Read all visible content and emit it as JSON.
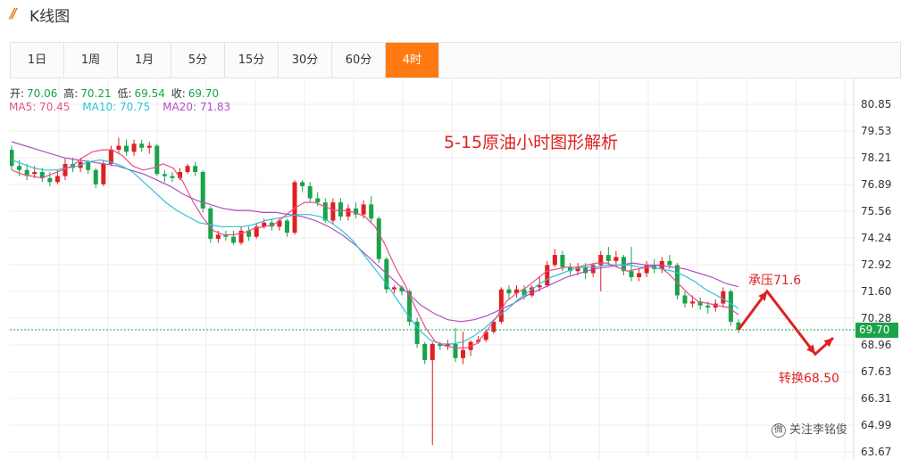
{
  "header": {
    "title": "K线图",
    "icon": "double-slash-icon",
    "accent": "#f07c14"
  },
  "tabs": [
    {
      "label": "1日"
    },
    {
      "label": "1周"
    },
    {
      "label": "1月"
    },
    {
      "label": "5分"
    },
    {
      "label": "15分"
    },
    {
      "label": "30分"
    },
    {
      "label": "60分"
    },
    {
      "label": "4时",
      "active": true
    }
  ],
  "ohlc": {
    "open_label": "开:",
    "open": "70.06",
    "high_label": "高:",
    "high": "70.21",
    "low_label": "低:",
    "low": "69.54",
    "close_label": "收:",
    "close": "69.70"
  },
  "ma": {
    "ma5": "MA5: 70.45",
    "ma10": "MA10: 70.75",
    "ma20": "MA20: 71.83"
  },
  "annotations": {
    "title": "5-15原油小时图形解析",
    "resistance": "承压71.6",
    "target": "转换68.50"
  },
  "watermark": {
    "text": "关注李铭俊",
    "icon": "weibo-icon"
  },
  "current_price": "69.70",
  "colors": {
    "up": "#e02020",
    "down": "#1aa34a",
    "ma5": "#e8508a",
    "ma10": "#2ec4d6",
    "ma20": "#b04fc4",
    "annotation": "#e02020",
    "tab_active": "#ff7a12"
  },
  "chart_data": {
    "type": "candlestick",
    "y_ticks": [
      "80.85",
      "79.53",
      "78.21",
      "76.89",
      "75.56",
      "74.24",
      "72.92",
      "71.60",
      "70.28",
      "68.96",
      "67.63",
      "66.31",
      "64.99",
      "63.67"
    ],
    "ylim": [
      63.67,
      80.85
    ],
    "grid": true,
    "candles": [
      [
        78.6,
        77.8,
        78.8,
        77.6
      ],
      [
        77.8,
        77.6,
        78.1,
        77.3
      ],
      [
        77.6,
        77.3,
        77.9,
        77.1
      ],
      [
        77.4,
        77.5,
        77.8,
        77.2
      ],
      [
        77.5,
        77.2,
        77.7,
        77.0
      ],
      [
        77.2,
        77.0,
        77.5,
        76.8
      ],
      [
        77.0,
        77.3,
        77.6,
        76.9
      ],
      [
        77.3,
        77.9,
        78.2,
        77.1
      ],
      [
        77.9,
        77.7,
        78.2,
        77.5
      ],
      [
        77.7,
        78.0,
        78.2,
        77.5
      ],
      [
        78.0,
        77.6,
        78.1,
        77.4
      ],
      [
        77.6,
        76.9,
        77.7,
        76.7
      ],
      [
        76.9,
        77.9,
        78.1,
        76.8
      ],
      [
        77.9,
        78.6,
        78.8,
        77.8
      ],
      [
        78.6,
        78.8,
        79.2,
        78.4
      ],
      [
        78.8,
        78.5,
        79.1,
        78.3
      ],
      [
        78.5,
        78.9,
        79.1,
        78.3
      ],
      [
        78.9,
        78.7,
        79.1,
        78.5
      ],
      [
        78.7,
        78.8,
        79.0,
        78.4
      ],
      [
        78.8,
        77.4,
        78.9,
        77.3
      ],
      [
        77.4,
        77.3,
        77.6,
        77.0
      ],
      [
        77.3,
        77.2,
        77.5,
        77.0
      ],
      [
        77.2,
        77.5,
        77.7,
        77.1
      ],
      [
        77.5,
        77.8,
        77.9,
        77.4
      ],
      [
        77.8,
        77.5,
        78.0,
        77.3
      ],
      [
        77.5,
        75.7,
        77.6,
        75.5
      ],
      [
        75.7,
        74.2,
        75.8,
        74.0
      ],
      [
        74.2,
        74.4,
        74.6,
        74.0
      ],
      [
        74.4,
        74.3,
        74.6,
        74.1
      ],
      [
        74.3,
        74.0,
        74.6,
        73.9
      ],
      [
        74.0,
        74.6,
        74.8,
        73.9
      ],
      [
        74.6,
        74.3,
        74.8,
        74.1
      ],
      [
        74.3,
        74.8,
        75.0,
        74.2
      ],
      [
        74.8,
        75.0,
        75.2,
        74.7
      ],
      [
        75.0,
        74.8,
        75.2,
        74.6
      ],
      [
        74.8,
        75.1,
        75.2,
        74.6
      ],
      [
        75.1,
        74.5,
        75.2,
        74.3
      ],
      [
        74.5,
        77.0,
        77.1,
        74.4
      ],
      [
        77.0,
        76.8,
        77.1,
        76.5
      ],
      [
        76.8,
        76.2,
        77.0,
        76.0
      ],
      [
        76.2,
        76.0,
        76.5,
        75.8
      ],
      [
        76.0,
        75.1,
        76.2,
        75.0
      ],
      [
        75.1,
        76.0,
        76.2,
        74.9
      ],
      [
        76.0,
        75.3,
        76.2,
        75.1
      ],
      [
        75.3,
        75.7,
        75.9,
        75.1
      ],
      [
        75.7,
        75.4,
        76.0,
        75.2
      ],
      [
        75.4,
        75.9,
        76.1,
        75.2
      ],
      [
        75.9,
        75.2,
        76.3,
        75.0
      ],
      [
        75.2,
        73.2,
        75.3,
        73.0
      ],
      [
        73.2,
        71.7,
        73.3,
        71.5
      ],
      [
        71.7,
        71.8,
        71.9,
        71.5
      ],
      [
        71.8,
        71.6,
        71.9,
        71.4
      ],
      [
        71.6,
        70.1,
        71.7,
        69.9
      ],
      [
        70.1,
        69.0,
        70.3,
        68.8
      ],
      [
        69.0,
        68.2,
        69.1,
        68.0
      ],
      [
        68.2,
        69.0,
        69.1,
        64.0
      ],
      [
        69.0,
        68.9,
        69.1,
        68.7
      ],
      [
        68.9,
        69.0,
        69.2,
        68.7
      ],
      [
        69.0,
        68.3,
        69.8,
        68.1
      ],
      [
        68.3,
        68.7,
        69.6,
        68.0
      ],
      [
        68.7,
        69.1,
        69.2,
        68.4
      ],
      [
        69.1,
        69.2,
        69.4,
        69.0
      ],
      [
        69.2,
        69.6,
        69.7,
        69.1
      ],
      [
        69.6,
        70.1,
        70.2,
        69.5
      ],
      [
        70.1,
        71.7,
        71.8,
        70.0
      ],
      [
        71.7,
        71.5,
        71.9,
        71.2
      ],
      [
        71.5,
        71.7,
        71.9,
        71.3
      ],
      [
        71.7,
        71.4,
        71.9,
        71.2
      ],
      [
        71.4,
        71.8,
        71.9,
        71.3
      ],
      [
        71.8,
        71.9,
        72.3,
        71.6
      ],
      [
        71.9,
        72.9,
        73.1,
        71.8
      ],
      [
        72.9,
        73.4,
        73.7,
        72.8
      ],
      [
        73.4,
        72.8,
        73.6,
        72.6
      ],
      [
        72.8,
        72.6,
        73.0,
        72.4
      ],
      [
        72.6,
        72.8,
        73.0,
        72.4
      ],
      [
        72.8,
        72.5,
        73.0,
        72.2
      ],
      [
        72.5,
        72.9,
        73.0,
        72.3
      ],
      [
        72.9,
        73.4,
        73.6,
        71.6
      ],
      [
        73.4,
        73.1,
        73.8,
        72.9
      ],
      [
        73.1,
        73.3,
        73.6,
        72.9
      ],
      [
        73.3,
        72.6,
        73.4,
        72.4
      ],
      [
        72.6,
        72.3,
        73.8,
        72.1
      ],
      [
        72.3,
        72.5,
        72.7,
        72.1
      ],
      [
        72.5,
        72.9,
        73.1,
        72.3
      ],
      [
        72.9,
        72.7,
        73.2,
        72.5
      ],
      [
        72.7,
        73.1,
        73.3,
        72.5
      ],
      [
        73.1,
        72.9,
        73.4,
        72.7
      ],
      [
        72.9,
        71.4,
        73.0,
        71.2
      ],
      [
        71.4,
        71.0,
        71.6,
        70.8
      ],
      [
        71.0,
        71.1,
        71.4,
        70.8
      ],
      [
        71.1,
        70.9,
        71.3,
        70.7
      ],
      [
        70.9,
        70.8,
        71.1,
        70.5
      ],
      [
        70.8,
        71.0,
        71.2,
        70.6
      ],
      [
        71.0,
        71.6,
        71.8,
        70.8
      ],
      [
        71.6,
        70.1,
        71.7,
        69.9
      ],
      [
        70.06,
        69.7,
        70.21,
        69.54
      ]
    ],
    "ma5": [
      77.6,
      77.4,
      77.3,
      77.2,
      77.4,
      77.6,
      77.8,
      78.2,
      78.5,
      78.6,
      78.6,
      78.3,
      77.8,
      77.6,
      77.7,
      77.9,
      77.7,
      77.0,
      76.0,
      75.2,
      74.6,
      74.4,
      74.4,
      74.5,
      74.7,
      74.8,
      74.9,
      75.3,
      75.7,
      76.0,
      76.0,
      75.8,
      75.6,
      75.6,
      75.5,
      75.3,
      74.8,
      73.9,
      72.8,
      71.9,
      70.8,
      69.8,
      69.1,
      68.9,
      68.8,
      68.8,
      69.0,
      69.6,
      70.3,
      71.1,
      71.5,
      71.8,
      72.2,
      72.6,
      72.7,
      72.8,
      72.8,
      72.9,
      73.0,
      73.0,
      72.8,
      72.6,
      72.7,
      72.8,
      72.9,
      72.5,
      72.0,
      71.5,
      71.1,
      71.0,
      70.9,
      70.8,
      70.45
    ],
    "ma10": [
      78.1,
      77.9,
      77.7,
      77.6,
      77.6,
      77.7,
      77.8,
      78.0,
      78.1,
      78.0,
      77.8,
      77.5,
      77.0,
      76.5,
      76.0,
      75.6,
      75.3,
      75.0,
      74.9,
      74.8,
      74.8,
      74.8,
      74.9,
      75.1,
      75.2,
      75.3,
      75.4,
      75.4,
      75.3,
      75.0,
      74.6,
      74.1,
      73.4,
      72.7,
      72.0,
      71.2,
      70.4,
      69.7,
      69.2,
      69.0,
      69.0,
      69.1,
      69.4,
      69.8,
      70.3,
      70.7,
      71.2,
      71.6,
      72.0,
      72.3,
      72.5,
      72.7,
      72.8,
      72.8,
      72.9,
      72.9,
      72.9,
      72.8,
      72.8,
      72.7,
      72.6,
      72.4,
      72.1,
      71.7,
      71.4,
      71.1,
      70.75
    ],
    "ma20": [
      79.0,
      78.8,
      78.6,
      78.4,
      78.2,
      78.1,
      78.0,
      77.9,
      77.8,
      77.6,
      77.4,
      77.1,
      76.8,
      76.4,
      76.1,
      75.9,
      75.7,
      75.6,
      75.6,
      75.5,
      75.5,
      75.4,
      75.3,
      75.1,
      74.8,
      74.4,
      73.9,
      73.3,
      72.7,
      72.1,
      71.5,
      70.9,
      70.5,
      70.2,
      70.1,
      70.2,
      70.4,
      70.7,
      71.0,
      71.4,
      71.7,
      72.0,
      72.3,
      72.5,
      72.7,
      72.8,
      72.9,
      73.0,
      72.9,
      72.9,
      72.8,
      72.7,
      72.5,
      72.3,
      72.0,
      71.83
    ],
    "current_price_line": 69.7,
    "forecast_path": [
      [
        0,
        69.7
      ],
      [
        1,
        71.6
      ],
      [
        2,
        68.5
      ],
      [
        3,
        69.3
      ]
    ]
  }
}
